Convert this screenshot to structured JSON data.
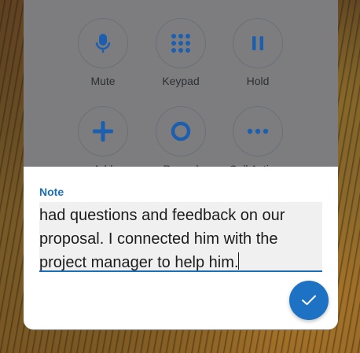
{
  "call_controls": {
    "row1": [
      {
        "label": "Mute",
        "icon": "microphone-icon"
      },
      {
        "label": "Keypad",
        "icon": "keypad-icon"
      },
      {
        "label": "Hold",
        "icon": "pause-icon"
      }
    ],
    "row2": [
      {
        "label": "Add",
        "icon": "plus-icon"
      },
      {
        "label": "Record",
        "icon": "record-icon"
      },
      {
        "label": "Call Actions",
        "icon": "more-icon"
      }
    ]
  },
  "note_dialog": {
    "label": "Note",
    "text": "had questions and feedback on our proposal. I connected him with the project manager to help him.",
    "done_icon": "checkmark-icon"
  },
  "colors": {
    "accent": "#1d72c4",
    "label_blue": "#1a6fb8",
    "icon_blue": "#1b5fae",
    "overlay": "#7d7d80"
  }
}
